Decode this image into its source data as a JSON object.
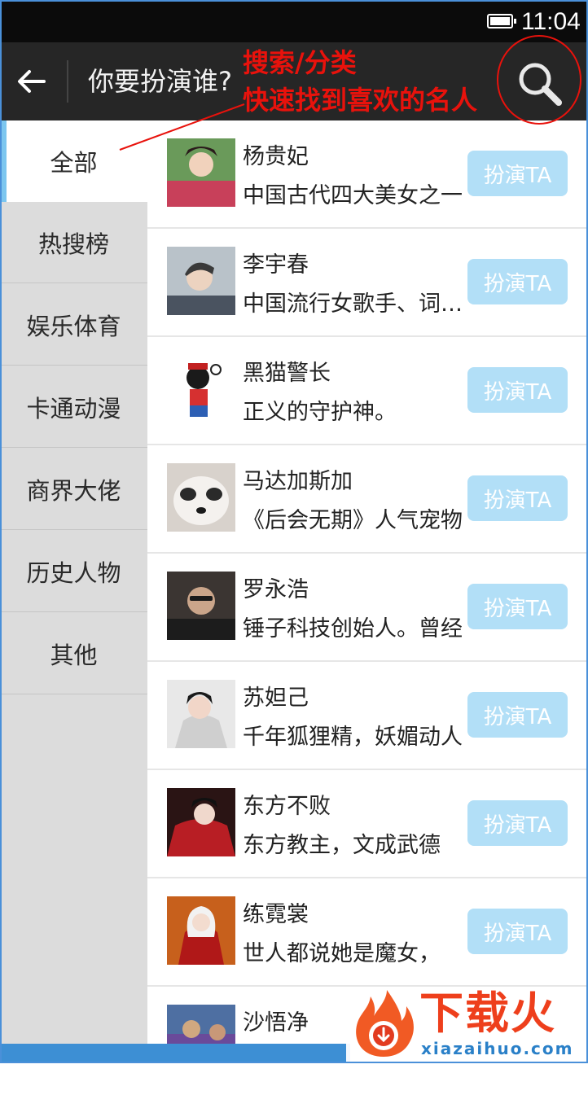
{
  "status_bar": {
    "time": "11:04",
    "icons": [
      "battery-icon"
    ]
  },
  "header": {
    "back_icon": "back-arrow-icon",
    "title": "你要扮演谁?",
    "search_icon": "search-icon"
  },
  "annotation": {
    "line1": "搜索/分类",
    "line2": "快速找到喜欢的名人",
    "color": "#e8120c"
  },
  "sidebar": {
    "items": [
      {
        "label": "全部",
        "active": true
      },
      {
        "label": "热搜榜"
      },
      {
        "label": "娱乐体育"
      },
      {
        "label": "卡通动漫"
      },
      {
        "label": "商界大佬"
      },
      {
        "label": "历史人物"
      },
      {
        "label": "其他"
      }
    ]
  },
  "list": {
    "items": [
      {
        "name": "杨贵妃",
        "desc": "中国古代四大美女之一",
        "button": "扮演TA"
      },
      {
        "name": "李宇春",
        "desc": "中国流行女歌手、词曲创作人",
        "button": "扮演TA"
      },
      {
        "name": "黑猫警长",
        "desc": "正义的守护神。",
        "button": "扮演TA"
      },
      {
        "name": "马达加斯加",
        "desc": "《后会无期》人气宠物",
        "button": "扮演TA"
      },
      {
        "name": "罗永浩",
        "desc": "锤子科技创始人。曾经",
        "button": "扮演TA"
      },
      {
        "name": "苏妲己",
        "desc": "千年狐狸精，妖媚动人",
        "button": "扮演TA"
      },
      {
        "name": "东方不败",
        "desc": "东方教主，文成武德",
        "button": "扮演TA"
      },
      {
        "name": "练霓裳",
        "desc": "世人都说她是魔女，",
        "button": "扮演TA"
      },
      {
        "name": "沙悟净",
        "desc": "",
        "button": ""
      }
    ]
  },
  "watermark": {
    "title": "下载火",
    "site": "xiazaihuo.com"
  },
  "colors": {
    "accent": "#7cc6ef",
    "button_bg": "#b2dff7",
    "app_bar": "#262626",
    "sidebar_bg": "#dcdcdc"
  }
}
